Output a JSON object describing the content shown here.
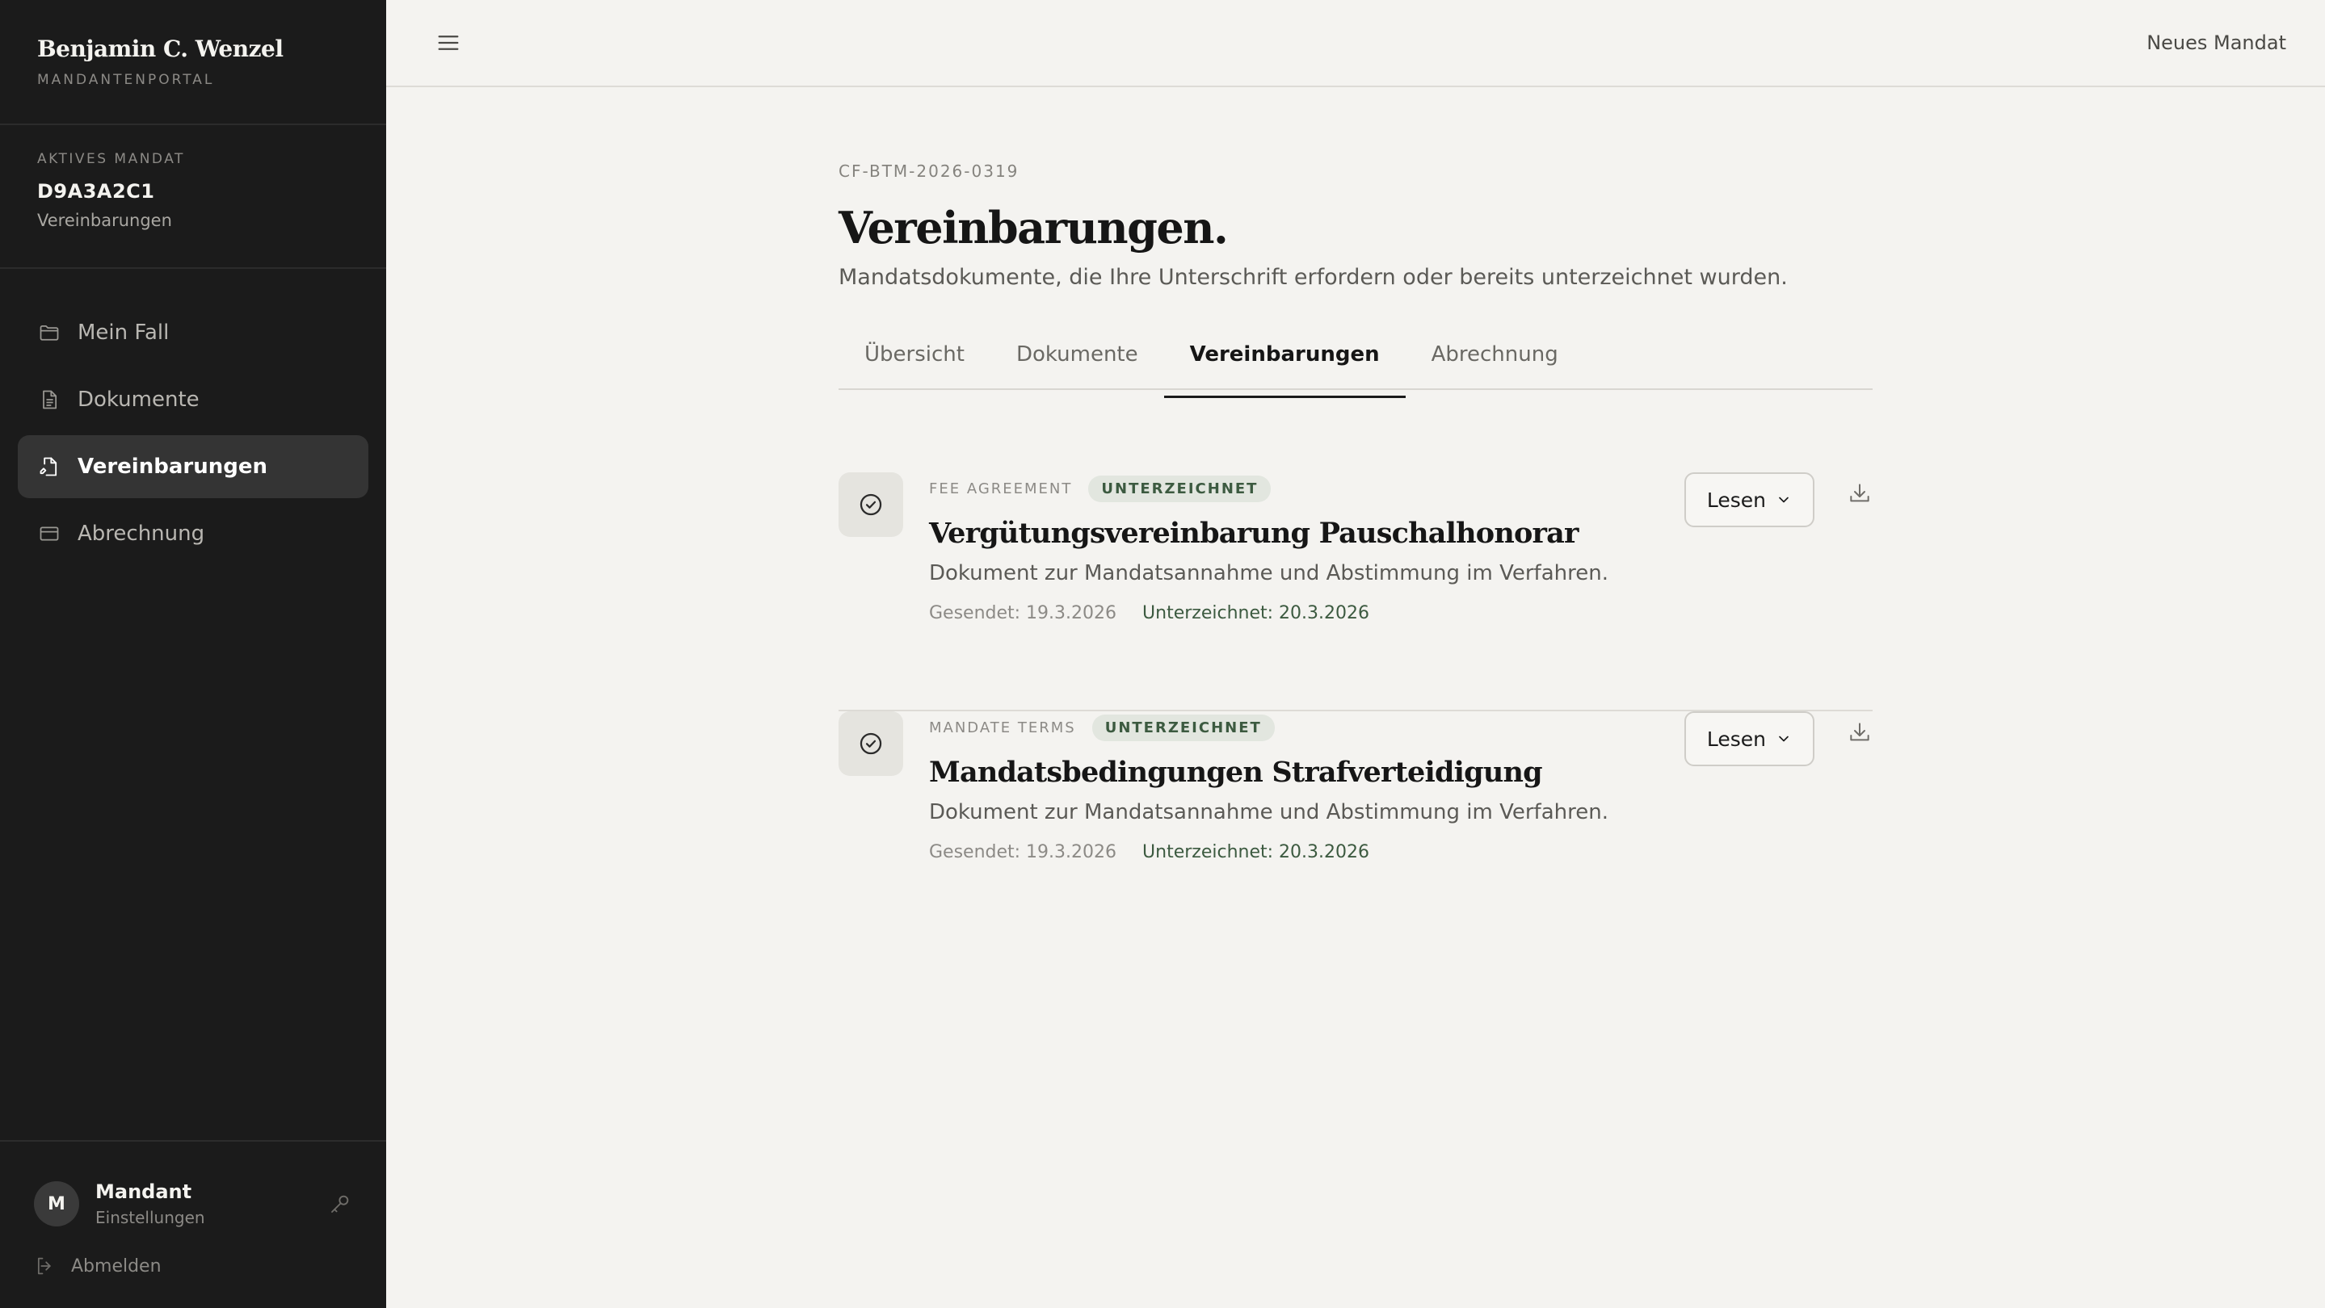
{
  "sidebar": {
    "brand_name": "Benjamin C. Wenzel",
    "brand_sub": "MANDANTENPORTAL",
    "active_mandate": {
      "label": "AKTIVES MANDAT",
      "id": "D9A3A2C1",
      "section": "Vereinbarungen"
    },
    "nav": [
      {
        "label": "Mein Fall",
        "icon": "folder-icon"
      },
      {
        "label": "Dokumente",
        "icon": "document-icon"
      },
      {
        "label": "Vereinbarungen",
        "icon": "signed-document-icon",
        "active": true
      },
      {
        "label": "Abrechnung",
        "icon": "credit-card-icon"
      }
    ],
    "user": {
      "initial": "M",
      "name": "Mandant",
      "settings": "Einstellungen",
      "logout": "Abmelden"
    }
  },
  "topbar": {
    "new_mandate": "Neues Mandat"
  },
  "page": {
    "case_number": "CF-BTM-2026-0319",
    "title": "Vereinbarungen.",
    "description": "Mandatsdokumente, die Ihre Unterschrift erfordern oder bereits unterzeichnet wurden."
  },
  "tabs": [
    {
      "label": "Übersicht"
    },
    {
      "label": "Dokumente"
    },
    {
      "label": "Vereinbarungen",
      "active": true
    },
    {
      "label": "Abrechnung"
    }
  ],
  "documents": [
    {
      "type": "FEE AGREEMENT",
      "status": "UNTERZEICHNET",
      "title": "Vergütungsvereinbarung Pauschalhonorar",
      "description": "Dokument zur Mandatsannahme und Abstimmung im Verfahren.",
      "sent": "Gesendet: 19.3.2026",
      "signed": "Unterzeichnet: 20.3.2026",
      "action": "Lesen"
    },
    {
      "type": "MANDATE TERMS",
      "status": "UNTERZEICHNET",
      "title": "Mandatsbedingungen Strafverteidigung",
      "description": "Dokument zur Mandatsannahme und Abstimmung im Verfahren.",
      "sent": "Gesendet: 19.3.2026",
      "signed": "Unterzeichnet: 20.3.2026",
      "action": "Lesen"
    }
  ],
  "colors": {
    "sidebar_bg": "#1b1b1b",
    "main_bg": "#f4f3f0",
    "signed_green": "#3c5a40",
    "badge_bg": "#e2e6df"
  }
}
